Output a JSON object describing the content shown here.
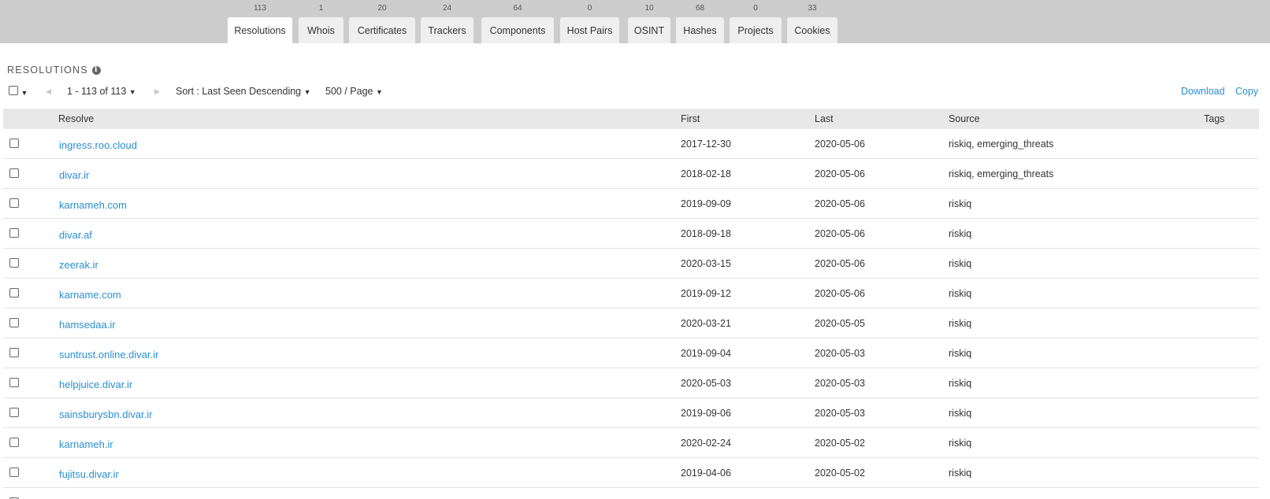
{
  "tabs": [
    {
      "label": "Resolutions",
      "count": "113",
      "active": true
    },
    {
      "label": "Whois",
      "count": "1"
    },
    {
      "label": "Certificates",
      "count": "20"
    },
    {
      "label": "Trackers",
      "count": "24"
    },
    {
      "label": "Components",
      "count": "64"
    },
    {
      "label": "Host Pairs",
      "count": "0"
    },
    {
      "label": "OSINT",
      "count": "10"
    },
    {
      "label": "Hashes",
      "count": "68"
    },
    {
      "label": "Projects",
      "count": "0"
    },
    {
      "label": "Cookies",
      "count": "33"
    }
  ],
  "section": {
    "title": "RESOLUTIONS",
    "info_icon": "info-icon"
  },
  "toolbar": {
    "pagination": "1 - 113 of 113",
    "sort": "Sort : Last Seen Descending",
    "per_page": "500 / Page",
    "download": "Download",
    "copy": "Copy"
  },
  "table": {
    "headers": {
      "resolve": "Resolve",
      "first": "First",
      "last": "Last",
      "source": "Source",
      "tags": "Tags"
    },
    "rows": [
      {
        "resolve": "ingress.roo.cloud",
        "first": "2017-12-30",
        "last": "2020-05-06",
        "source": "riskiq, emerging_threats"
      },
      {
        "resolve": "divar.ir",
        "first": "2018-02-18",
        "last": "2020-05-06",
        "source": "riskiq, emerging_threats"
      },
      {
        "resolve": "karnameh.com",
        "first": "2019-09-09",
        "last": "2020-05-06",
        "source": "riskiq"
      },
      {
        "resolve": "divar.af",
        "first": "2018-09-18",
        "last": "2020-05-06",
        "source": "riskiq"
      },
      {
        "resolve": "zeerak.ir",
        "first": "2020-03-15",
        "last": "2020-05-06",
        "source": "riskiq"
      },
      {
        "resolve": "karname.com",
        "first": "2019-09-12",
        "last": "2020-05-06",
        "source": "riskiq"
      },
      {
        "resolve": "hamsedaa.ir",
        "first": "2020-03-21",
        "last": "2020-05-05",
        "source": "riskiq"
      },
      {
        "resolve": "suntrust.online.divar.ir",
        "first": "2019-09-04",
        "last": "2020-05-03",
        "source": "riskiq"
      },
      {
        "resolve": "helpjuice.divar.ir",
        "first": "2020-05-03",
        "last": "2020-05-03",
        "source": "riskiq"
      },
      {
        "resolve": "sainsburysbn.divar.ir",
        "first": "2019-09-06",
        "last": "2020-05-03",
        "source": "riskiq"
      },
      {
        "resolve": "karnameh.ir",
        "first": "2020-02-24",
        "last": "2020-05-02",
        "source": "riskiq"
      },
      {
        "resolve": "fujitsu.divar.ir",
        "first": "2019-04-06",
        "last": "2020-05-02",
        "source": "riskiq"
      }
    ]
  }
}
